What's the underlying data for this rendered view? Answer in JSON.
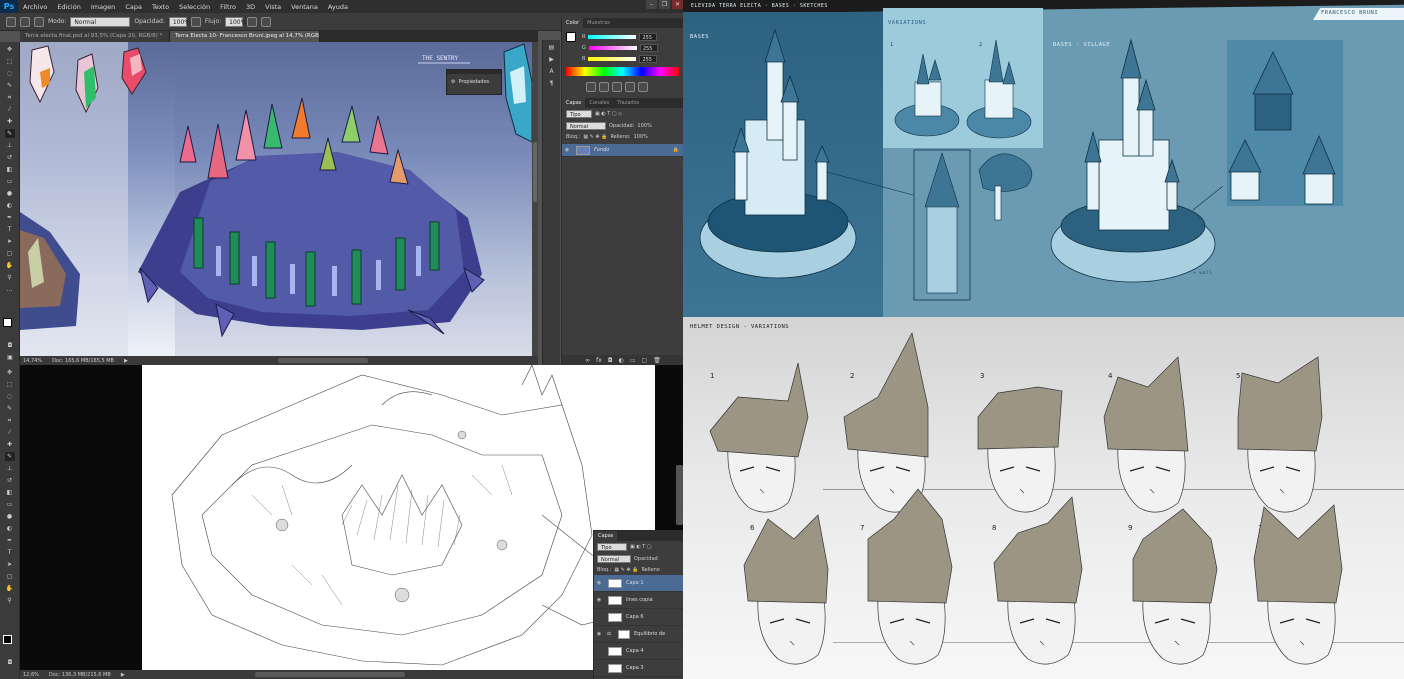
{
  "ps_top": {
    "app_logo": "Ps",
    "menu": [
      "Archivo",
      "Edición",
      "Imagen",
      "Capa",
      "Texto",
      "Selección",
      "Filtro",
      "3D",
      "Vista",
      "Ventana",
      "Ayuda"
    ],
    "options": {
      "mode_label": "Modo:",
      "mode_value": "Normal",
      "opacity_label": "Opacidad:",
      "opacity_value": "100%",
      "flow_label": "Flujo:",
      "flow_value": "100%"
    },
    "tabs": [
      "Terra electa final.psd al 93,5% (Capa 20, RGB/8) *",
      "Terra Electa 10- Francesco Bruni.jpeg al 14,7% (RGB/8)"
    ],
    "canvas_label": "THE SENTRY",
    "properties_label": "Propiedades",
    "color_panel": {
      "tabs": [
        "Color",
        "Muestras"
      ],
      "r_label": "R",
      "g_label": "G",
      "b_label": "B",
      "r": "255",
      "g": "255",
      "b": "255"
    },
    "layers_panel": {
      "tabs": [
        "Capas",
        "Canales",
        "Trazados"
      ],
      "kind": "Tipo",
      "blend": "Normal",
      "opacity_label": "Opacidad:",
      "opacity": "100%",
      "lock_label": "Bloq.:",
      "fill_label": "Relleno:",
      "fill": "100%",
      "layer_name": "Fondo"
    },
    "status": {
      "zoom": "14,74%",
      "doc": "Doc: 165,6 MB/165,5 MB"
    }
  },
  "ps_bottom": {
    "layers_panel": {
      "title": "Capas",
      "kind": "Tipo",
      "blend": "Normal",
      "opacity_label": "Opacidad",
      "lock_label": "Bloq.:",
      "fill_label": "Relleno",
      "layers": [
        "Capa 1",
        "lines copia",
        "Capa 6",
        "Equilibrio de",
        "Capa 4",
        "Capa 3"
      ]
    },
    "status": {
      "zoom": "12,6%",
      "doc": "Doc: 136,3 MB/215,6 MB"
    }
  },
  "castle_sheet": {
    "header": "ELEVIDA TERRA ELECTA · BASES · SKETCHES",
    "author": "FRANCESCO BRUNI",
    "section_bases": "BASES",
    "section_variations": "VARIATIONS",
    "section_village": "BASES · VILLAGE",
    "num_1": "1",
    "num_2": "2",
    "note": "+ wall"
  },
  "helmet_sheet": {
    "title": "HELMET DESIGN - VARIATIONS",
    "numbers": [
      "1",
      "2",
      "3",
      "4",
      "5",
      "6",
      "7",
      "8",
      "9",
      "10"
    ]
  }
}
